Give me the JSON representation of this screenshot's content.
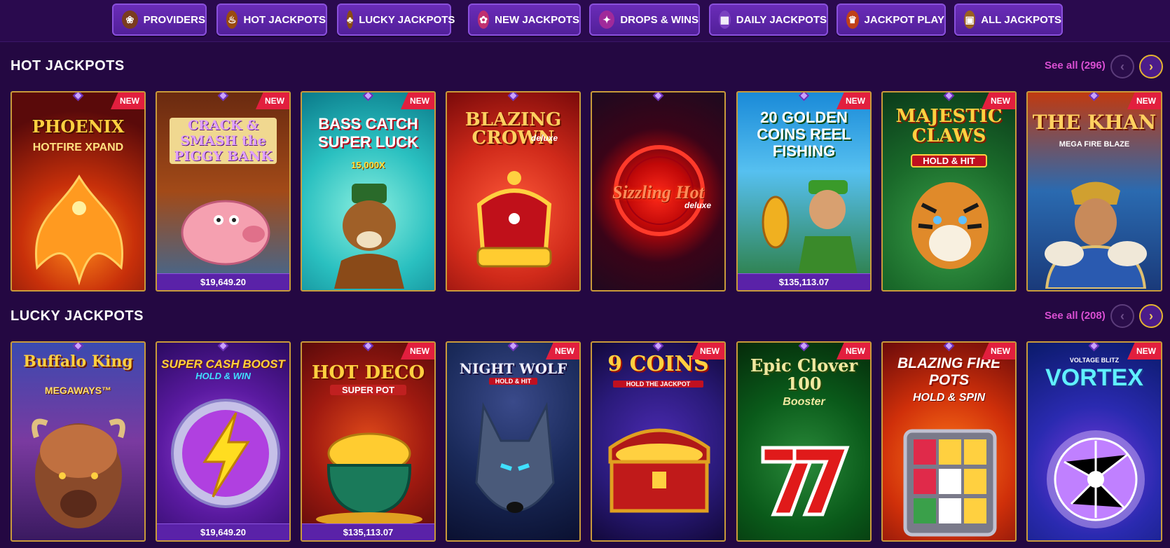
{
  "nav": [
    {
      "label": "PROVIDERS",
      "icon": "scroll-icon",
      "glyph": "❀",
      "color": "#e0b060"
    },
    {
      "label": "HOT JACKPOTS",
      "icon": "flame-bag-icon",
      "glyph": "♨",
      "color": "#f0a030"
    },
    {
      "label": "LUCKY JACKPOTS",
      "icon": "lucky-bag-icon",
      "glyph": "♣",
      "color": "#c07020"
    },
    {
      "label": "NEW JACKPOTS",
      "icon": "clover-icon",
      "glyph": "✿",
      "color": "#e05080"
    },
    {
      "label": "DROPS & WINS",
      "icon": "drops-wins-icon",
      "glyph": "✦",
      "color": "#d040c0"
    },
    {
      "label": "DAILY JACKPOTS",
      "icon": "calendar-icon",
      "glyph": "▦",
      "color": "#c080ff"
    },
    {
      "label": "JACKPOT PLAY",
      "icon": "jackpot-play-icon",
      "glyph": "♛",
      "color": "#e05020"
    },
    {
      "label": "ALL JACKPOTS",
      "icon": "treasure-chest-icon",
      "glyph": "▣",
      "color": "#d09030"
    }
  ],
  "sections": [
    {
      "title": "HOT JACKPOTS",
      "see_all": "See all (296)",
      "games": [
        {
          "title": "PHOENIX",
          "subtitle": "HOTFIRE XPAND",
          "new": true,
          "prize": "",
          "badge": "NEW"
        },
        {
          "title": "CRACK & SMASH the PIGGY BANK",
          "subtitle": "",
          "new": true,
          "prize": "$19,649.20",
          "badge": "NEW"
        },
        {
          "title": "BASS CATCH SUPER LUCK",
          "subtitle": "15,000X",
          "new": true,
          "prize": "",
          "badge": "NEW"
        },
        {
          "title": "BLAZING CROWN",
          "subtitle": "deluxe",
          "new": false,
          "prize": "",
          "badge": ""
        },
        {
          "title": "Sizzling Hot",
          "subtitle": "deluxe",
          "new": false,
          "prize": "",
          "badge": ""
        },
        {
          "title": "20 GOLDEN COINS REEL FISHING",
          "subtitle": "",
          "new": true,
          "prize": "$135,113.07",
          "badge": "NEW"
        },
        {
          "title": "MAJESTIC CLAWS",
          "subtitle": "HOLD & HIT",
          "new": true,
          "prize": "",
          "badge": "NEW"
        },
        {
          "title": "THE KHAN",
          "subtitle": "MEGA FIRE BLAZE",
          "new": true,
          "prize": "",
          "badge": "NEW"
        }
      ]
    },
    {
      "title": "LUCKY JACKPOTS",
      "see_all": "See all (208)",
      "games": [
        {
          "title": "Buffalo King",
          "subtitle": "MEGAWAYS™",
          "new": false,
          "prize": "",
          "badge": ""
        },
        {
          "title": "SUPER CASH BOOST",
          "subtitle": "HOLD & WIN",
          "new": false,
          "prize": "$19,649.20",
          "badge": ""
        },
        {
          "title": "HOT DECO",
          "subtitle": "SUPER POT",
          "new": true,
          "prize": "$135,113.07",
          "badge": "NEW"
        },
        {
          "title": "NIGHT WOLF",
          "subtitle": "HOLD & HIT",
          "new": true,
          "prize": "",
          "badge": "NEW"
        },
        {
          "title": "9 COINS",
          "subtitle": "HOLD THE JACKPOT",
          "new": true,
          "prize": "",
          "badge": "NEW"
        },
        {
          "title": "Epic Clover 100",
          "subtitle": "Booster",
          "new": true,
          "prize": "",
          "badge": "NEW"
        },
        {
          "title": "BLAZING FIRE POTS",
          "subtitle": "HOLD & SPIN",
          "new": true,
          "prize": "",
          "badge": "NEW"
        },
        {
          "title": "VORTEX",
          "subtitle": "VOLTAGE BLITZ",
          "new": true,
          "prize": "",
          "badge": "NEW"
        }
      ]
    }
  ]
}
